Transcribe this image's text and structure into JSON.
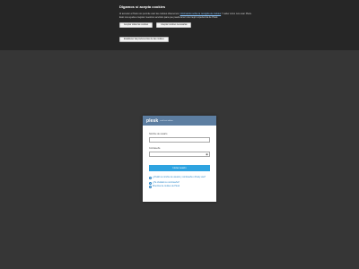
{
  "cookie_banner": {
    "title": "Digamos sí acepta cookies",
    "text_intro": "Al acceder a Plesk nos permite usar las cookies obtenemos.",
    "link": "Información sobre la recogida de cookies",
    "text_rest": "Y saber cómo nos usan Plesk. Esto nos ayuda a mejorar nuestros servicios para que pueda tener una mejor experiencia de Plesk.",
    "accept_all_label": "Aceptar todas las cookies",
    "accept_necessary_label": "Aceptar cookies necesarias",
    "customize_label": "Establecer las preferencias de las cookies"
  },
  "login": {
    "logo": "plesk",
    "logo_sub": "web host edition",
    "username_label": "Nombre de usuario",
    "password_label": "Contraseña",
    "eye_icon": "eye-icon",
    "submit_label": "Iniciar sesión",
    "help_links": [
      {
        "icon": "help-icon",
        "text": "¿Olvidó su nombre de usuario y contraseña o Pesky usa?"
      },
      {
        "icon": "help-icon",
        "text": "¿Ha olvidado su contraseña?"
      },
      {
        "icon": "help-icon",
        "text": "Directiva de cookies de Plesk"
      }
    ]
  },
  "colors": {
    "header_blue": "#5d7ea1",
    "button_blue": "#2ea3e0",
    "link_blue": "#2a86c8",
    "banner_bg": "#262626"
  }
}
